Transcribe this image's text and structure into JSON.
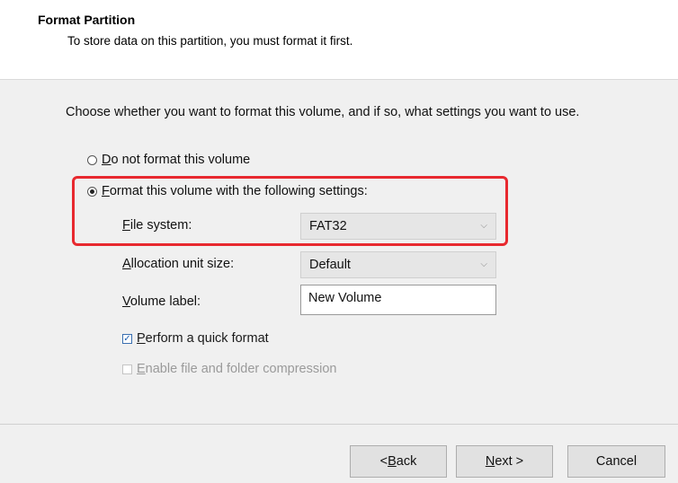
{
  "header": {
    "title": "Format Partition",
    "subtitle": "To store data on this partition, you must format it first."
  },
  "instruction": "Choose whether you want to format this volume, and if so, what settings you want to use.",
  "options": {
    "no_format": {
      "prefix": "",
      "accel": "D",
      "rest": "o not format this volume",
      "selected": false
    },
    "format": {
      "prefix": "",
      "accel": "F",
      "rest": "ormat this volume with the following settings:",
      "selected": true
    }
  },
  "settings": {
    "file_system": {
      "accel": "F",
      "rest": "ile system:",
      "value": "FAT32"
    },
    "allocation": {
      "prefix": "",
      "accel": "A",
      "rest": "llocation unit size:",
      "value": "Default"
    },
    "volume_label": {
      "accel": "V",
      "rest": "olume label:",
      "value": "New Volume"
    }
  },
  "quick_format": {
    "accel": "P",
    "rest": "erform a quick format",
    "checked": true
  },
  "compression": {
    "accel": "E",
    "rest": "nable file and folder compression",
    "checked": false,
    "enabled": false
  },
  "buttons": {
    "back": {
      "prefix": "< ",
      "accel": "B",
      "rest": "ack"
    },
    "next": {
      "accel": "N",
      "rest": "ext >"
    },
    "cancel": "Cancel"
  },
  "colors": {
    "highlight": "#e8292f",
    "window_bg": "#f0f0f0",
    "header_bg": "#ffffff"
  },
  "icons": {
    "dropdown": "chevron-down-icon",
    "radio_checked": "radio-checked-icon",
    "radio_unchecked": "radio-unchecked-icon",
    "checkbox_checked": "checkbox-checked-icon",
    "checkbox_disabled": "checkbox-disabled-icon"
  }
}
